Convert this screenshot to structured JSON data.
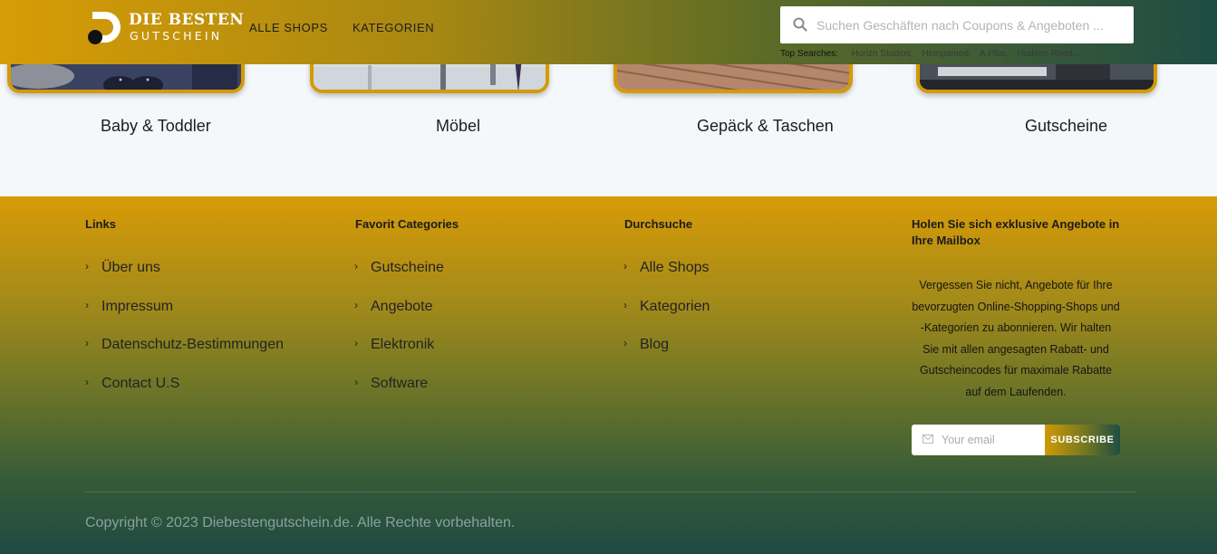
{
  "header": {
    "logo": {
      "line1": "DIE BESTEN",
      "line2": "GUTSCHEIN"
    },
    "nav": [
      {
        "label": "ALLE SHOPS"
      },
      {
        "label": "KATEGORIEN"
      }
    ],
    "search": {
      "placeholder": "Suchen Geschäften nach Coupons & Angeboten ...",
      "icon": "search-icon"
    },
    "top_searches": {
      "label": "Top Searches:",
      "items": [
        "Horizn Studios,",
        "Hempamed,",
        "A.Plus,",
        "Hudson Reed,..."
      ]
    }
  },
  "categories": [
    {
      "title": "Baby & Toddler"
    },
    {
      "title": "Möbel"
    },
    {
      "title": "Gepäck & Taschen"
    },
    {
      "title": "Gutscheine"
    }
  ],
  "footer": {
    "links": {
      "title": "Links",
      "items": [
        "Über uns",
        "Impressum",
        "Datenschutz-Bestimmungen",
        "Contact U.S"
      ]
    },
    "favorit": {
      "title": "Favorit Categories",
      "items": [
        "Gutscheine",
        "Angebote",
        "Elektronik",
        "Software"
      ]
    },
    "durchsuche": {
      "title": "Durchsuche",
      "items": [
        "Alle Shops",
        "Kategorien",
        "Blog"
      ]
    },
    "newsletter": {
      "title": "Holen Sie sich exklusive Angebote in Ihre Mailbox",
      "text": "Vergessen Sie nicht, Angebote für Ihre bevorzugten Online-Shopping-Shops und -Kategorien zu abonnieren. Wir halten Sie mit allen angesagten Rabatt- und Gutscheincodes für maximale Rabatte auf dem Laufenden.",
      "email_placeholder": "Your email",
      "subscribe_label": "SUBSCRIBE"
    },
    "copyright": "Copyright © 2023 Diebestengutschein.de. Alle Rechte vorbehalten."
  },
  "colors": {
    "brand_gold": "#d79c06",
    "brand_green": "#1e4c44"
  }
}
